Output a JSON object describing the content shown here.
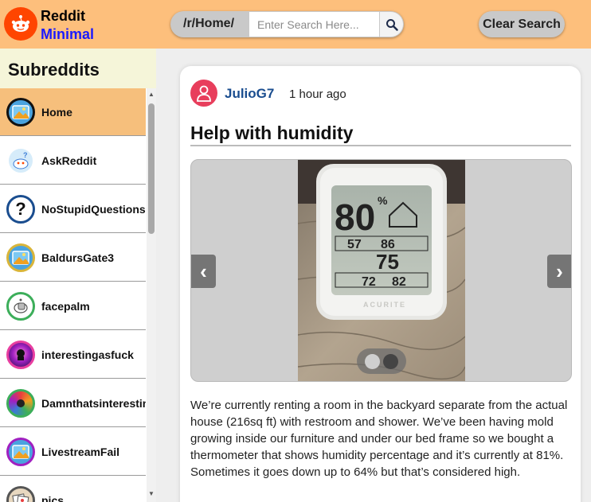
{
  "header": {
    "logo_line1": "Reddit",
    "logo_line2": "Minimal",
    "logo_icon": "reddit-alien-icon",
    "search_prefix": "/r/Home/",
    "search_placeholder": "Enter Search Here...",
    "search_value": "",
    "search_icon": "magnifier-icon",
    "clear_label": "Clear Search"
  },
  "sidebar": {
    "title": "Subreddits",
    "items": [
      {
        "label": "Home",
        "icon": "home-image-icon",
        "active": true
      },
      {
        "label": "AskReddit",
        "icon": "askreddit-icon",
        "active": false
      },
      {
        "label": "NoStupidQuestions",
        "icon": "question-mark-icon",
        "active": false
      },
      {
        "label": "BaldursGate3",
        "icon": "baldursgate3-image-icon",
        "active": false
      },
      {
        "label": "facepalm",
        "icon": "facepalm-icon",
        "active": false
      },
      {
        "label": "interestingasfuck",
        "icon": "interestingasfuck-icon",
        "active": false
      },
      {
        "label": "Damnthatsinteresting",
        "icon": "damnthatsinteresting-icon",
        "active": false
      },
      {
        "label": "LivestreamFail",
        "icon": "livestreamfail-image-icon",
        "active": false
      },
      {
        "label": "pics",
        "icon": "pics-icon",
        "active": false
      }
    ]
  },
  "post": {
    "author": "JulioG7",
    "time": "1 hour ago",
    "title": "Help with humidity",
    "gallery": {
      "prev_icon": "chevron-left-icon",
      "next_icon": "chevron-right-icon",
      "image_count": 2,
      "current_index": 2,
      "hygrometer": {
        "humidity": "80",
        "min_humidity": "57",
        "max_humidity": "86",
        "temperature": "75",
        "min_temp": "72",
        "max_temp": "82",
        "brand": "ACURITE"
      }
    },
    "body": "We’re currently renting a room in the backyard separate from the actual house (216sq ft) with restroom and shower. We’ve been having mold growing inside our furniture and under our bed frame so we bought a thermometer that shows humidity percentage and it’s currently at 81%. Sometimes it goes down up to 64% but that’s considered high."
  },
  "colors": {
    "header_bg": "#fdbf7c",
    "active_item_bg": "#f6bf7c",
    "sidebar_title_bg": "#f5f5d9",
    "author_color": "#1a4d8f",
    "logo_accent": "#1a1aff",
    "reddit_orange": "#ff4500"
  }
}
